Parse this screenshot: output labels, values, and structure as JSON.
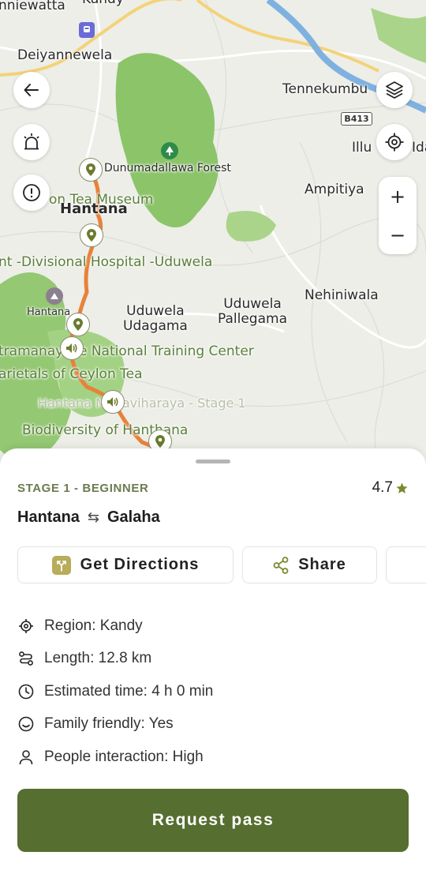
{
  "map": {
    "labels": {
      "kandy": "Kandy",
      "nniewatta": "nniewatta",
      "deiyannewela": "Deiyannewela",
      "tennekumbura": "Tennekumbu",
      "illu": "Illu",
      "ida": "Ida",
      "ampitiya": "Ampitiya",
      "dunumadallawa": "Dunumadallawa Forest",
      "tea_museum": "on Tea Museum",
      "hantana": "Hantana",
      "hospital": "nt -Divisional Hospital -Uduwela",
      "hantana_peak": "Hantana",
      "uduwela_udagama": "Uduwela\nUdagama",
      "uduwela_pallegama": "Uduwela\nPallegama",
      "nehiniwala": "Nehiniwala",
      "training_center": "tramanayake National Training Center",
      "varietals": "arietals of Ceylon Tea",
      "stage_faded": "Hantana Mahaviharaya - Stage 1",
      "biodiversity": "Biodiversity of Hanthana"
    },
    "road_shield": "B413",
    "zoom_in": "+",
    "zoom_out": "−"
  },
  "sheet": {
    "stage": "STAGE 1 - BEGINNER",
    "rating": "4.7",
    "route_from": "Hantana",
    "route_arrow": "⇆",
    "route_to": "Galaha",
    "actions": {
      "directions": "Get Directions",
      "share": "Share"
    },
    "info": {
      "region": "Region: Kandy",
      "length": "Length: 12.8 km",
      "time": "Estimated time: 4 h 0 min",
      "family": "Family friendly: Yes",
      "people": "People interaction: High"
    },
    "cta": "Request pass"
  },
  "colors": {
    "accent": "#566e30",
    "route": "#e8813a",
    "forest": "#8fc470",
    "star": "#7a8a2e"
  }
}
